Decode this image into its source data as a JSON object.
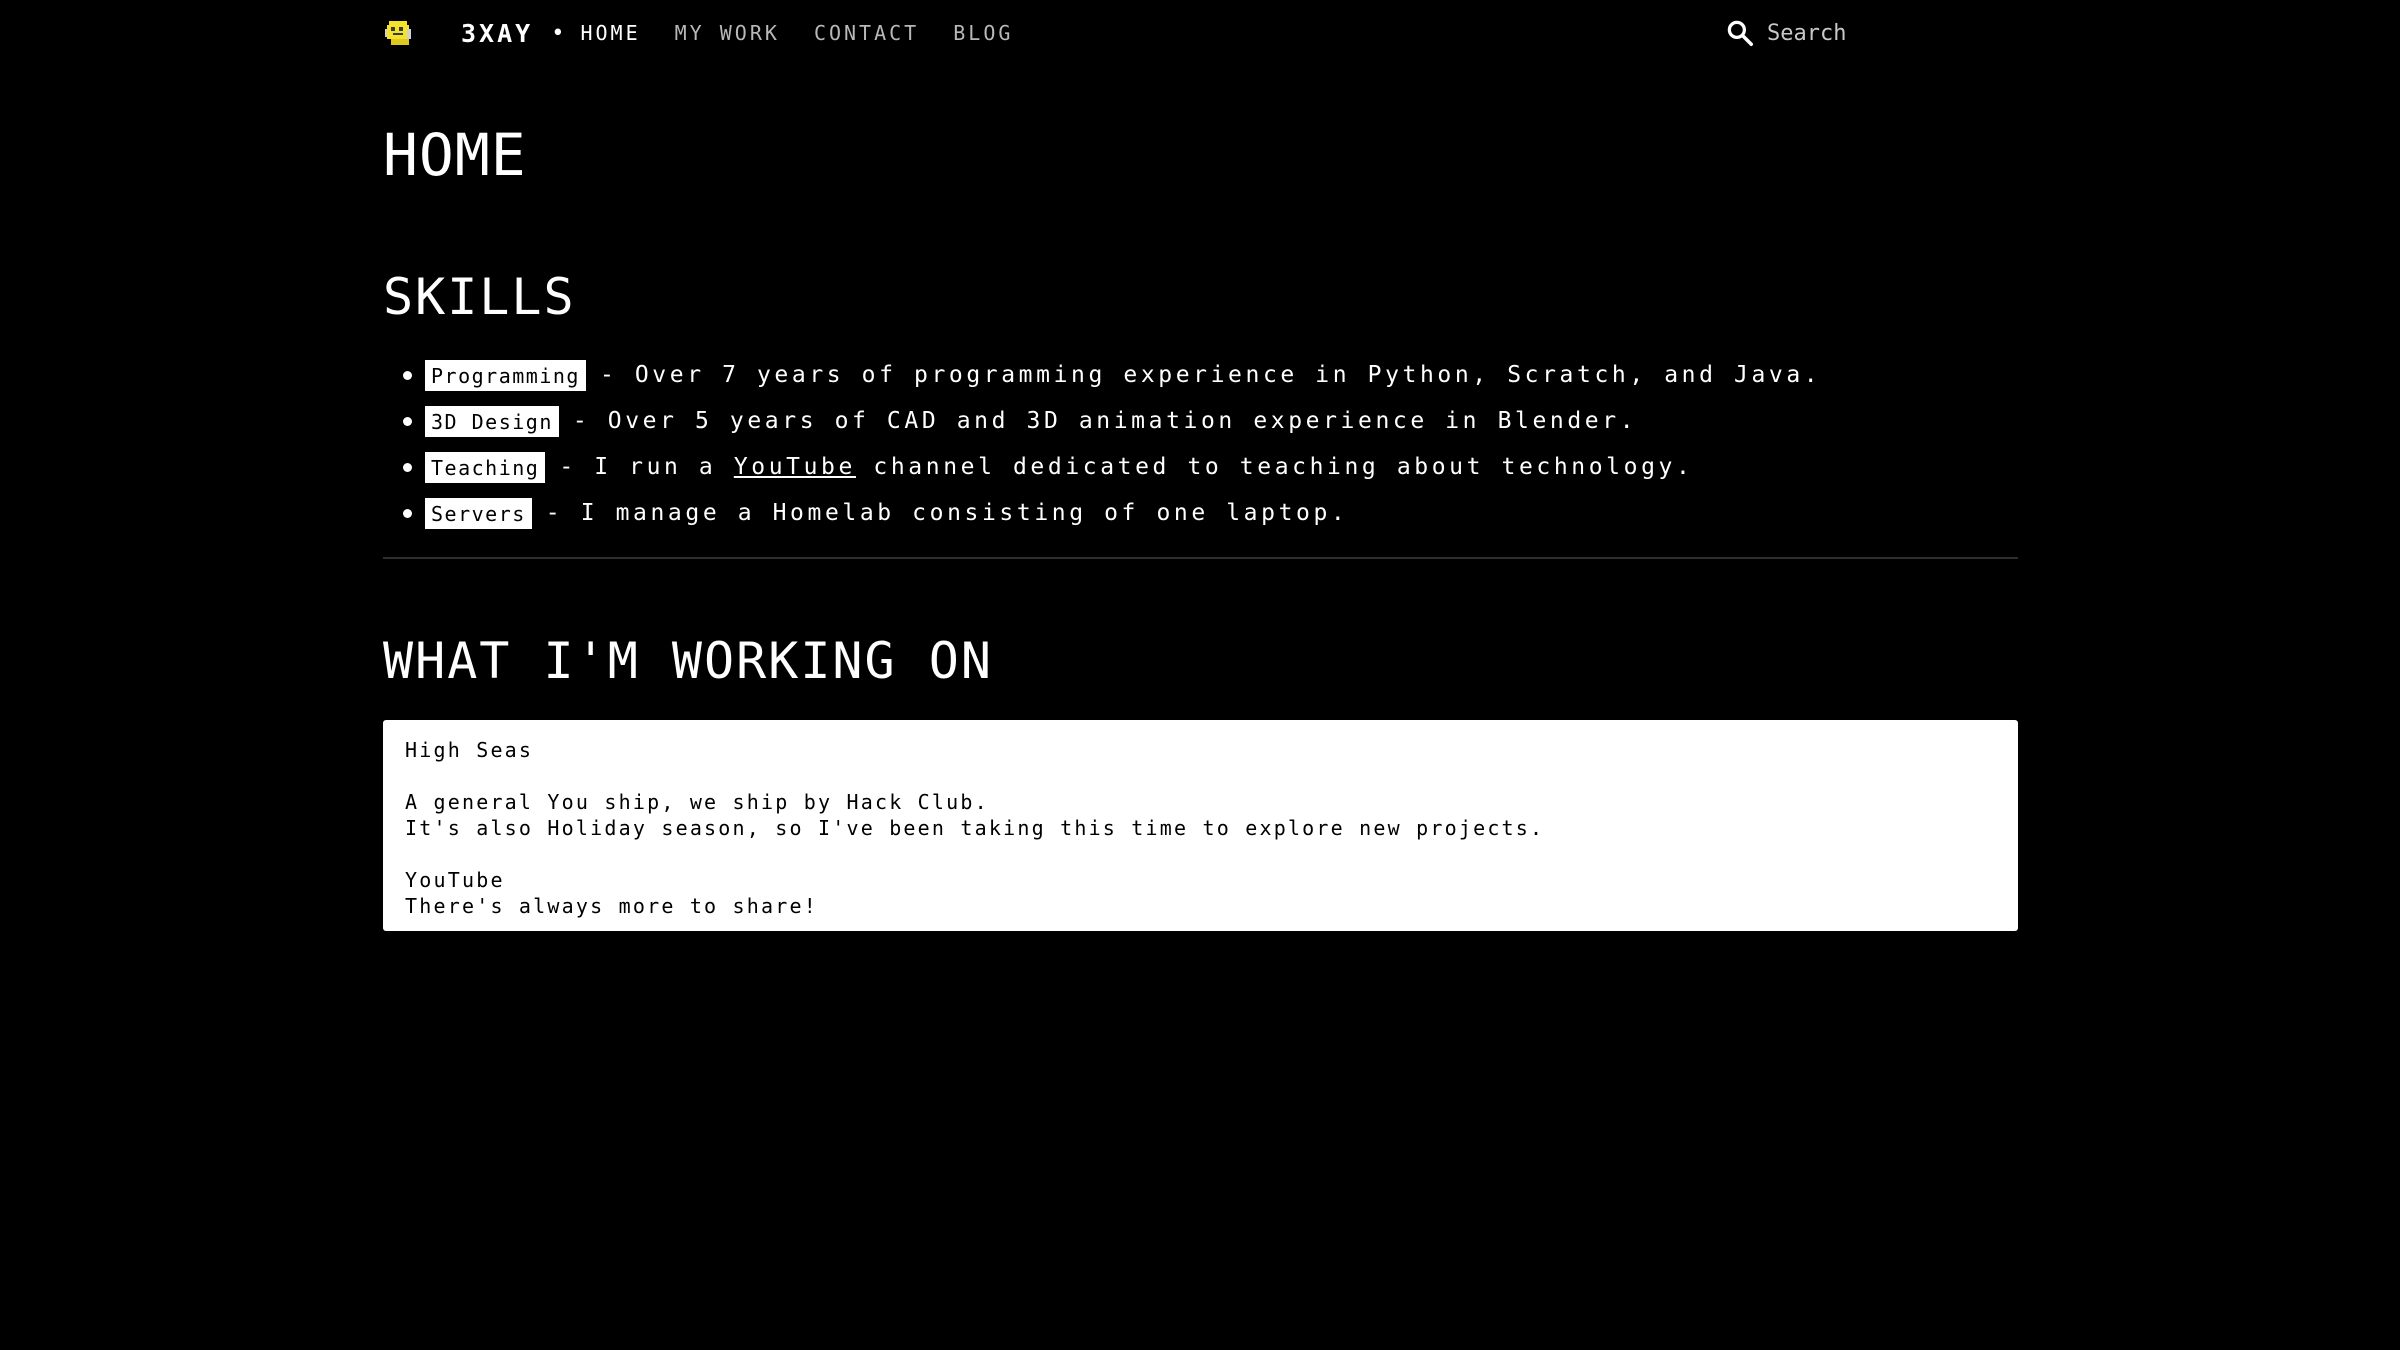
{
  "header": {
    "site_title": "3XAY",
    "separator": "•",
    "nav": [
      {
        "label": "HOME",
        "active": true
      },
      {
        "label": "MY WORK",
        "active": false
      },
      {
        "label": "CONTACT",
        "active": false
      },
      {
        "label": "BLOG",
        "active": false
      }
    ],
    "search": {
      "placeholder": "Search",
      "value": "",
      "icon": "search-icon"
    },
    "logo_icon": "pixel-logo-icon"
  },
  "main": {
    "page_title": "HOME",
    "skills": {
      "title": "SKILLS",
      "items": [
        {
          "tag": "Programming",
          "text": "- Over 7 years of programming experience in Python, Scratch, and Java."
        },
        {
          "tag": "3D Design",
          "text": "- Over 5 years of CAD and 3D animation experience in Blender."
        },
        {
          "tag": "Teaching",
          "text_before": "- I run a",
          "link": "YouTube",
          "text_after": "channel dedicated to teaching about technology."
        },
        {
          "tag": "Servers",
          "text": "- I manage a Homelab consisting of one laptop."
        }
      ]
    },
    "working_on": {
      "title": "WHAT I'M WORKING ON",
      "lines": [
        "High Seas",
        "",
        "A general You ship, we ship by Hack Club.",
        "It's also Holiday season, so I've been taking this time to explore new projects.",
        "",
        "YouTube",
        "There's always more to share!"
      ]
    }
  },
  "colors": {
    "background": "#000000",
    "text": "#ffffff",
    "nav_inactive": "#b8b8b8",
    "logo_yellow": "#f2e22b",
    "divider": "#2e2e2e"
  }
}
